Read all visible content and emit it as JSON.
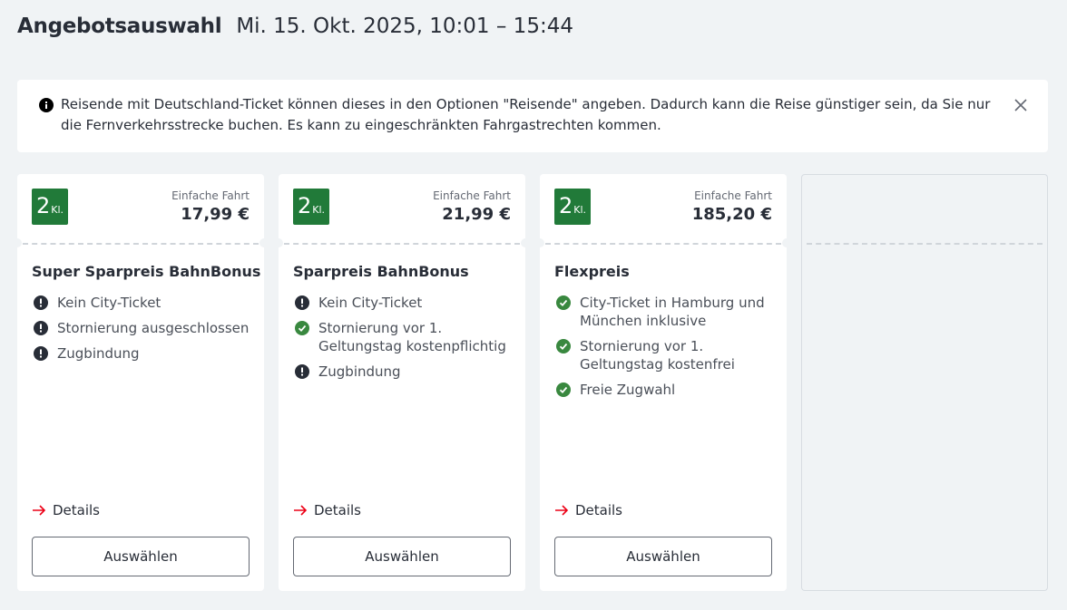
{
  "header": {
    "title": "Angebotsauswahl",
    "date_range": "Mi. 15. Okt. 2025, 10:01 – 15:44"
  },
  "notice": {
    "text": "Reisende mit Deutschland-Ticket können dieses in den Optionen \"Reisende\" angeben. Dadurch kann die Reise günstiger sein, da Sie nur die Fernverkehrsstrecke buchen. Es kann zu eingeschränkten Fahrgastrechten kommen.",
    "icon": "info-icon",
    "close_icon": "close-icon"
  },
  "colors": {
    "class_badge": "#217a39",
    "check": "#39883f",
    "alert": "#282d37",
    "details_arrow": "#ec0016"
  },
  "offers": [
    {
      "class_number": "2",
      "class_suffix": "Kl.",
      "fare_type": "Einfache Fahrt",
      "price": "17,99 €",
      "name": "Super Sparpreis BahnBonus",
      "features": [
        {
          "icon": "alert",
          "text": "Kein City-Ticket"
        },
        {
          "icon": "alert",
          "text": "Stornierung ausgeschlossen"
        },
        {
          "icon": "alert",
          "text": "Zugbindung"
        }
      ],
      "details_label": "Details",
      "select_label": "Auswählen"
    },
    {
      "class_number": "2",
      "class_suffix": "Kl.",
      "fare_type": "Einfache Fahrt",
      "price": "21,99 €",
      "name": "Sparpreis BahnBonus",
      "features": [
        {
          "icon": "alert",
          "text": "Kein City-Ticket"
        },
        {
          "icon": "check",
          "text": "Stornierung vor 1. Geltungstag kostenpflichtig"
        },
        {
          "icon": "alert",
          "text": "Zugbindung"
        }
      ],
      "details_label": "Details",
      "select_label": "Auswählen"
    },
    {
      "class_number": "2",
      "class_suffix": "Kl.",
      "fare_type": "Einfache Fahrt",
      "price": "185,20 €",
      "name": "Flexpreis",
      "features": [
        {
          "icon": "check",
          "text": "City-Ticket in Hamburg und München inklusive"
        },
        {
          "icon": "check",
          "text": "Stornierung vor 1. Geltungstag kostenfrei"
        },
        {
          "icon": "check",
          "text": "Freie Zugwahl"
        }
      ],
      "details_label": "Details",
      "select_label": "Auswählen"
    }
  ]
}
